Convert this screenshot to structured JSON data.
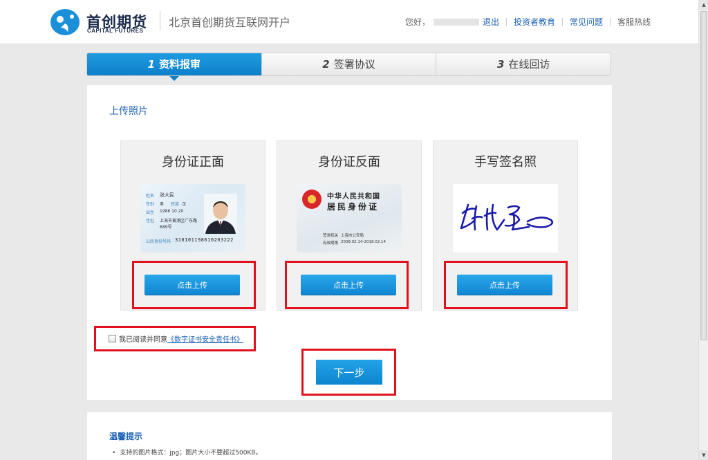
{
  "header": {
    "logo_cn": "首创期货",
    "logo_en": "CAPITAL FUTURES",
    "site_title": "北京首创期货互联网开户",
    "greeting": "您好，",
    "links": {
      "logout": "退出",
      "investor_education": "投资者教育",
      "faq": "常见问题",
      "hotline": "客服热线"
    }
  },
  "steps": [
    {
      "num": "1",
      "label": "资料报审"
    },
    {
      "num": "2",
      "label": "签署协议"
    },
    {
      "num": "3",
      "label": "在线回访"
    }
  ],
  "main": {
    "section_title": "上传照片",
    "cards": [
      {
        "title": "身份证正面",
        "button": "点击上传"
      },
      {
        "title": "身份证反面",
        "button": "点击上传"
      },
      {
        "title": "手写签名照",
        "button": "点击上传"
      }
    ],
    "id_front": {
      "name": "张大民",
      "gender": "男",
      "ethnicity": "汉",
      "birth": "1986  10  20",
      "address1": "上海市黄浦区广东路",
      "address2": "689号",
      "id_label": "公民身份号码",
      "id_number": "310101198610203222"
    },
    "id_back": {
      "line1": "中华人民共和国",
      "line2": "居民身份证",
      "authority_label": "签发机关",
      "authority": "上海市公安局",
      "valid_label": "有效期限",
      "valid": "2008.02.14-2018.02.14"
    },
    "agreement": {
      "prefix": "我已阅读并同意",
      "link": "《数字证书安全责任书》"
    },
    "next_button": "下一步"
  },
  "tips": {
    "title": "温馨提示",
    "items": [
      "支持的图片格式：jpg；图片大小不要超过500KB。"
    ]
  },
  "colors": {
    "accent": "#0f86d2",
    "link": "#1a5fb4",
    "highlight": "#e0101c"
  }
}
